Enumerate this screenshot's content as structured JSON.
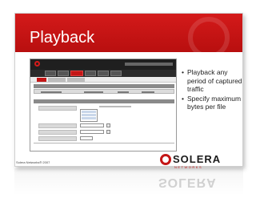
{
  "slide": {
    "title": "Playback",
    "bullets": [
      "Playback any period of captured traffic",
      "Specify maximum bytes per file"
    ],
    "copyright": "Solera Networks® 2007"
  },
  "logo": {
    "name": "SOLERA",
    "tagline": "NETWORKS"
  },
  "reflection": {
    "text": "SOLERA"
  },
  "colors": {
    "brand_red": "#c41616",
    "title_band": "#d41a1a",
    "app_header": "#1f1f1f"
  },
  "icons": {
    "logo_mark": "ring-icon"
  }
}
